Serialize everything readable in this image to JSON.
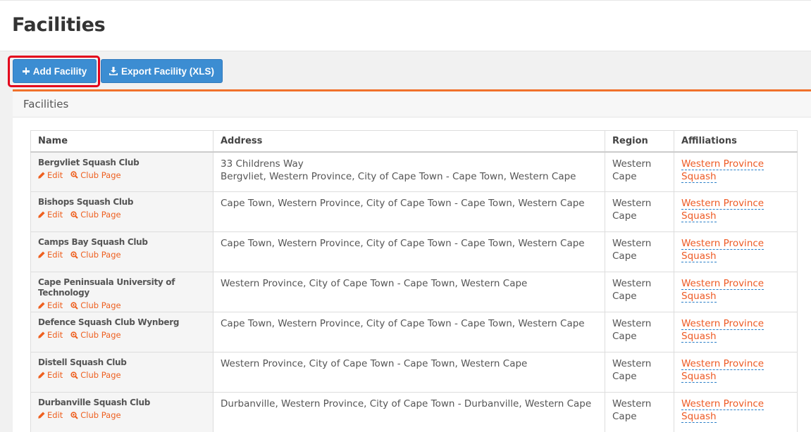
{
  "page": {
    "title": "Facilities"
  },
  "toolbar": {
    "add_label": "Add Facility",
    "export_label": "Export Facility (XLS)"
  },
  "panel": {
    "title": "Facilities"
  },
  "table": {
    "headers": {
      "name": "Name",
      "address": "Address",
      "region": "Region",
      "affiliations": "Affiliations"
    },
    "action_labels": {
      "edit": "Edit",
      "club_page": "Club Page"
    },
    "rows": [
      {
        "name": "Bergvliet Squash Club",
        "address_line1": "33 Childrens Way",
        "address_line2": "Bergvliet, Western Province, City of Cape Town - Cape Town, Western Cape",
        "region_line1": "Western",
        "region_line2": "Cape",
        "affiliation": "Western Province Squash"
      },
      {
        "name": "Bishops Squash Club",
        "address_line1": "Cape Town, Western Province, City of Cape Town - Cape Town, Western Cape",
        "address_line2": "",
        "region_line1": "Western",
        "region_line2": "Cape",
        "affiliation": "Western Province Squash"
      },
      {
        "name": "Camps Bay Squash Club",
        "address_line1": "Cape Town, Western Province, City of Cape Town - Cape Town, Western Cape",
        "address_line2": "",
        "region_line1": "Western",
        "region_line2": "Cape",
        "affiliation": "Western Province Squash"
      },
      {
        "name": "Cape Peninsuala University of Technology",
        "address_line1": "Western Province, City of Cape Town - Cape Town, Western Cape",
        "address_line2": "",
        "region_line1": "Western",
        "region_line2": "Cape",
        "affiliation": "Western Province Squash"
      },
      {
        "name": "Defence Squash Club Wynberg",
        "address_line1": "Cape Town, Western Province, City of Cape Town - Cape Town, Western Cape",
        "address_line2": "",
        "region_line1": "Western",
        "region_line2": "Cape",
        "affiliation": "Western Province Squash"
      },
      {
        "name": "Distell Squash Club",
        "address_line1": "Western Province, City of Cape Town - Cape Town, Western Cape",
        "address_line2": "",
        "region_line1": "Western",
        "region_line2": "Cape",
        "affiliation": "Western Province Squash"
      },
      {
        "name": "Durbanville Squash Club",
        "address_line1": "Durbanville, Western Province, City of Cape Town - Durbanville, Western Cape",
        "address_line2": "",
        "region_line1": "Western",
        "region_line2": "Cape",
        "affiliation": "Western Province Squash"
      }
    ]
  },
  "colors": {
    "primary_button": "#3c8dd2",
    "accent": "#f0712b",
    "highlight": "#e3001b",
    "link": "#ee5a24"
  },
  "icons": {
    "add": "plus-icon",
    "export": "download-icon",
    "edit": "pencil-icon",
    "club_page": "zoom-icon"
  }
}
